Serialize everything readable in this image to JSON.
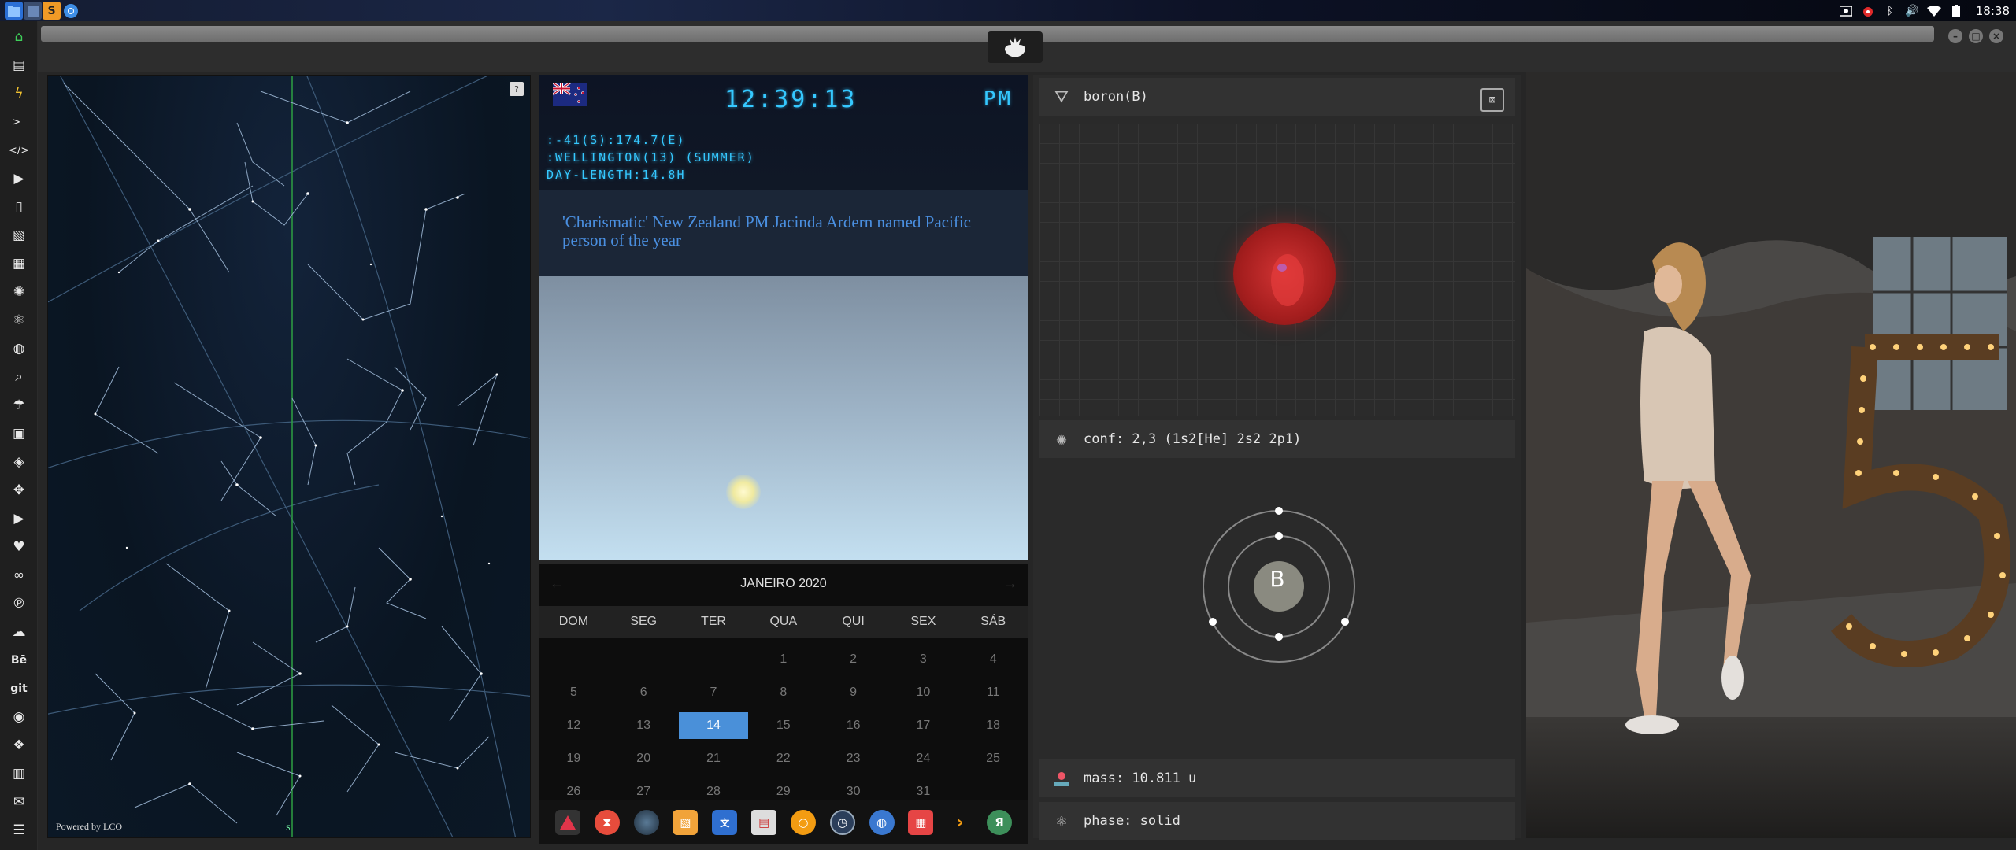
{
  "tray": {
    "time": "18:38"
  },
  "starmap": {
    "credit": "Powered by LCO",
    "help": "?",
    "south_label": "S"
  },
  "clock": {
    "time": "12:39:13",
    "ampm": "PM",
    "coords": ":-41(S):174.7(E)",
    "location": ":WELLINGTON(13) (SUMMER)",
    "day_length": "DAY-LENGTH:14.8H"
  },
  "news": {
    "headline": "'Charismatic' New Zealand PM Jacinda Ardern named Pacific person of the year"
  },
  "calendar": {
    "month": "JANEIRO 2020",
    "days_of_week": [
      "DOM",
      "SEG",
      "TER",
      "QUA",
      "QUI",
      "SEX",
      "SÁB"
    ],
    "weeks": [
      [
        "",
        "",
        "",
        "1",
        "2",
        "3",
        "4"
      ],
      [
        "5",
        "6",
        "7",
        "8",
        "9",
        "10",
        "11"
      ],
      [
        "12",
        "13",
        "14",
        "15",
        "16",
        "17",
        "18"
      ],
      [
        "19",
        "20",
        "21",
        "22",
        "23",
        "24",
        "25"
      ],
      [
        "26",
        "27",
        "28",
        "29",
        "30",
        "31",
        ""
      ]
    ],
    "today": "14"
  },
  "element": {
    "name": "boron(B)",
    "configuration": "conf: 2,3 (1s2[He] 2s2 2p1)",
    "symbol": "B",
    "mass": "mass: 10.811 u",
    "phase": "phase: solid"
  },
  "dock_icons": [
    "linux-icon",
    "timer-icon",
    "planet-icon",
    "image-viewer-icon",
    "translate-icon",
    "news-icon",
    "search-icon",
    "clock-icon",
    "globe-icon",
    "calendar-icon",
    "sublime-icon",
    "yandex-icon"
  ],
  "colors": {
    "digital": "#35c8ff",
    "today": "#4a90d9",
    "nucleus": "#d23434"
  }
}
